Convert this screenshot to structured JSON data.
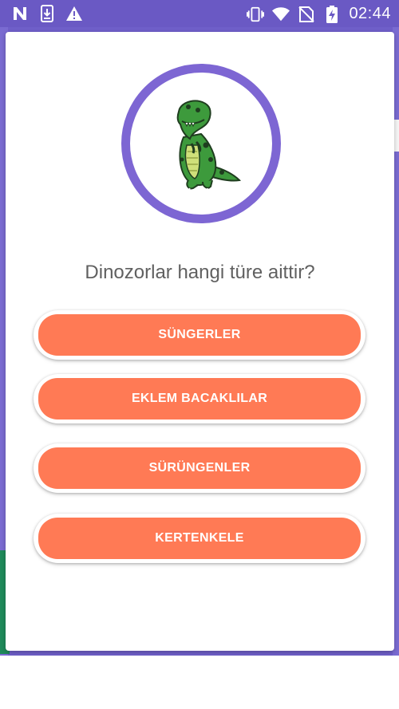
{
  "status_bar": {
    "time": "02:44",
    "icons_left": [
      "n-app-icon",
      "download-icon",
      "warning-icon"
    ],
    "icons_right": [
      "vibrate-icon",
      "wifi-icon",
      "no-sim-icon",
      "battery-charging-icon"
    ]
  },
  "quiz": {
    "image": "dinosaur-icon",
    "question": "Dinozorlar hangi türe aittir?",
    "options": [
      {
        "label": "SÜNGERLER"
      },
      {
        "label": "EKLEM BACAKLILAR"
      },
      {
        "label": "SÜRÜNGENLER"
      },
      {
        "label": "KERTENKELE"
      }
    ]
  },
  "colors": {
    "primary": "#6a59c4",
    "ring": "#7d66d3",
    "button": "#ff7a55",
    "text": "#606060"
  }
}
